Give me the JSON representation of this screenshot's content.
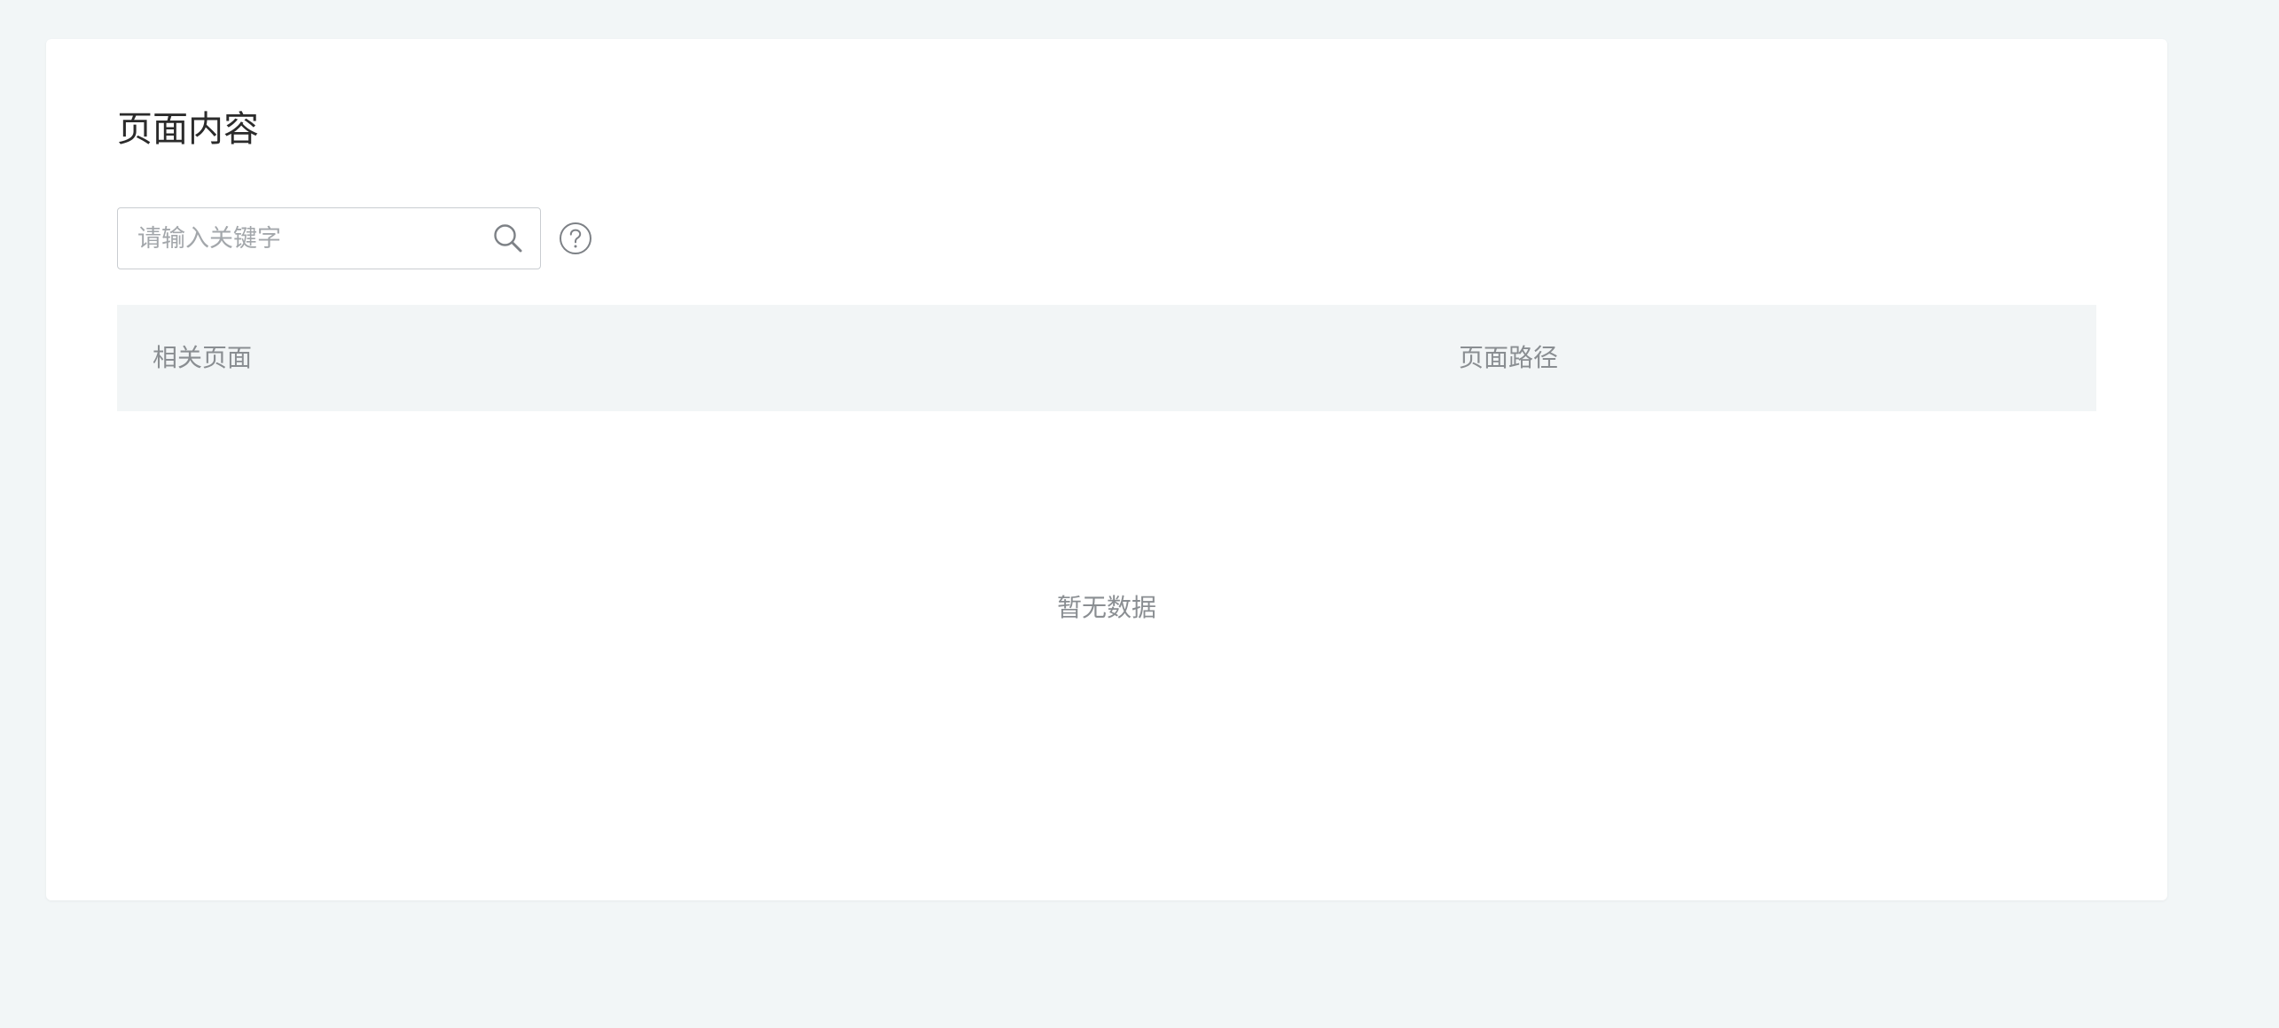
{
  "page": {
    "title": "页面内容"
  },
  "search": {
    "placeholder": "请输入关键字",
    "value": "",
    "search_icon": "search-icon",
    "help_icon": "question-circle-icon"
  },
  "table": {
    "columns": [
      {
        "label": "相关页面"
      },
      {
        "label": "页面路径"
      }
    ],
    "rows": [],
    "empty_text": "暂无数据"
  },
  "colors": {
    "background": "#f2f6f7",
    "card": "#ffffff",
    "header_bg": "#f2f5f6",
    "muted_text": "#8a8e92",
    "title_text": "#2b2b2b"
  }
}
